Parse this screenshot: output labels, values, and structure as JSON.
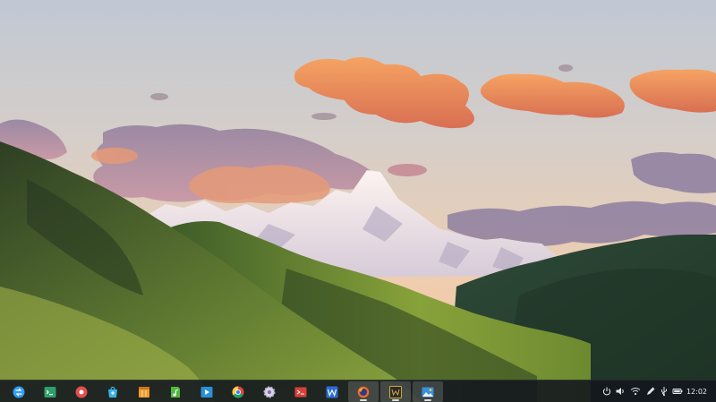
{
  "desktop": {
    "wallpaper": {
      "description": "",
      "colors": {
        "sky_top": "#c5cdd9",
        "sky_bottom": "#f1c9a6",
        "cloud": "#f39456",
        "snow": "#f4eef2",
        "hill_dark": "#33492b",
        "hill_light": "#7c9b3b"
      }
    }
  },
  "dock": {
    "apps": [
      {
        "name": "launcher",
        "icon": "launcher-icon",
        "color": "#2f9df5"
      },
      {
        "name": "terminal",
        "icon": "terminal-icon",
        "color": "#2ea06a"
      },
      {
        "name": "screen-recorder",
        "icon": "record-icon",
        "color": "#e44d4d"
      },
      {
        "name": "app-store",
        "icon": "store-icon",
        "color": "#3ab2e8"
      },
      {
        "name": "archive-manager",
        "icon": "archive-icon",
        "color": "#f19a2b"
      },
      {
        "name": "music",
        "icon": "music-icon",
        "color": "#52b83e"
      },
      {
        "name": "video-player",
        "icon": "video-icon",
        "color": "#2c8fd7"
      },
      {
        "name": "chrome",
        "icon": "chrome-icon",
        "color": "#4285f4"
      },
      {
        "name": "settings",
        "icon": "gear-icon",
        "color": "#d9d9e6"
      },
      {
        "name": "remote-desktop",
        "icon": "remote-icon",
        "color": "#d8413a"
      },
      {
        "name": "wps-writer",
        "icon": "writer-icon",
        "color": "#2d6bd3"
      },
      {
        "name": "firefox",
        "icon": "firefox-icon",
        "color": "#ef6b1f",
        "active": true
      },
      {
        "name": "editor",
        "icon": "editor-icon",
        "color": "#d3a842",
        "active": true
      },
      {
        "name": "image-viewer",
        "icon": "image-viewer-icon",
        "color": "#3c8fd8",
        "active": true
      }
    ]
  },
  "tray": {
    "icons": [
      "power-icon",
      "volume-icon",
      "wifi-icon",
      "pen-icon",
      "usb-icon",
      "battery-icon"
    ],
    "time": "12:02"
  }
}
